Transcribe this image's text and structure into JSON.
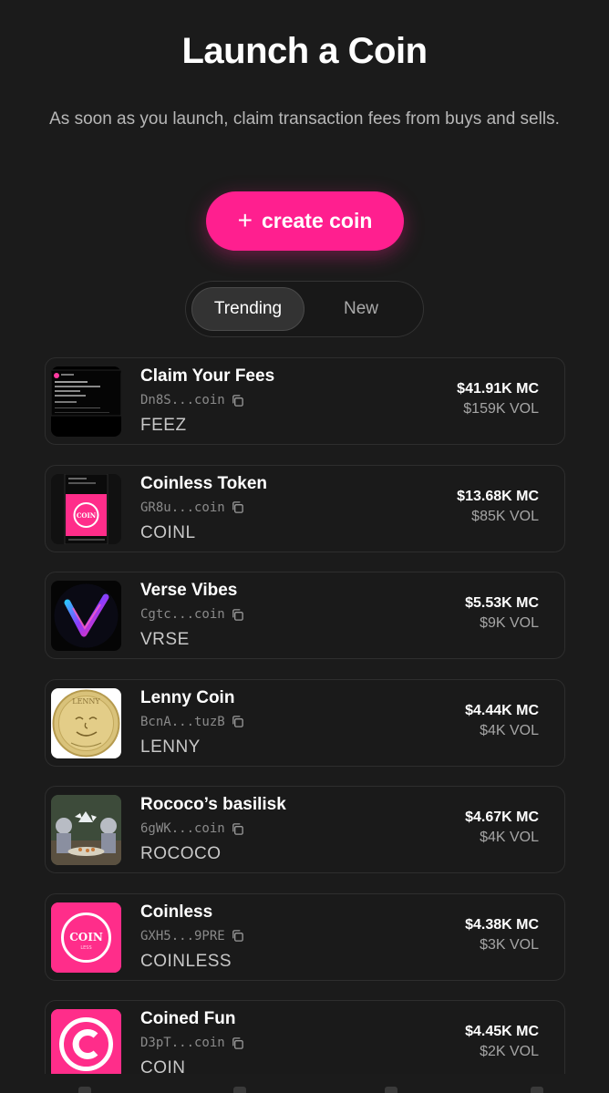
{
  "header": {
    "title": "Launch a Coin",
    "subtitle": "As soon as you launch, claim transaction fees from buys and sells."
  },
  "create_button": {
    "icon": "plus-icon",
    "label": "create coin",
    "color": "#ff1f8f"
  },
  "tabs": [
    {
      "label": "Trending",
      "active": true
    },
    {
      "label": "New",
      "active": false
    }
  ],
  "coins": [
    {
      "name": "Claim Your Fees",
      "address": "Dn8S...coin",
      "ticker": "FEEZ",
      "market_cap": "$41.91K MC",
      "volume": "$159K VOL",
      "thumb_icon": "tweet-screenshot-thumbnail"
    },
    {
      "name": "Coinless Token",
      "address": "GR8u...coin",
      "ticker": "COINL",
      "market_cap": "$13.68K MC",
      "volume": "$85K VOL",
      "thumb_icon": "phone-screenshot-thumbnail",
      "thumb_text": "COIN"
    },
    {
      "name": "Verse Vibes",
      "address": "Cgtc...coin",
      "ticker": "VRSE",
      "market_cap": "$5.53K MC",
      "volume": "$9K VOL",
      "thumb_icon": "neon-v-logo"
    },
    {
      "name": "Lenny Coin",
      "address": "BcnA...tuzB",
      "ticker": "LENNY",
      "market_cap": "$4.44K MC",
      "volume": "$4K VOL",
      "thumb_icon": "gold-coin-face",
      "thumb_text": "LENNY"
    },
    {
      "name": "Rococo’s basilisk",
      "address": "6gWK...coin",
      "ticker": "ROCOCO",
      "market_cap": "$4.67K MC",
      "volume": "$4K VOL",
      "thumb_icon": "rococo-painting"
    },
    {
      "name": "Coinless",
      "address": "GXH5...9PRE",
      "ticker": "COINLESS",
      "market_cap": "$4.38K MC",
      "volume": "$3K VOL",
      "thumb_icon": "coinless-logo",
      "thumb_text": "COIN",
      "thumb_subtext": "LESS"
    },
    {
      "name": "Coined Fun",
      "address": "D3pT...coin",
      "ticker": "COIN",
      "market_cap": "$4.45K MC",
      "volume": "$2K VOL",
      "thumb_icon": "copyright-c-logo"
    }
  ]
}
